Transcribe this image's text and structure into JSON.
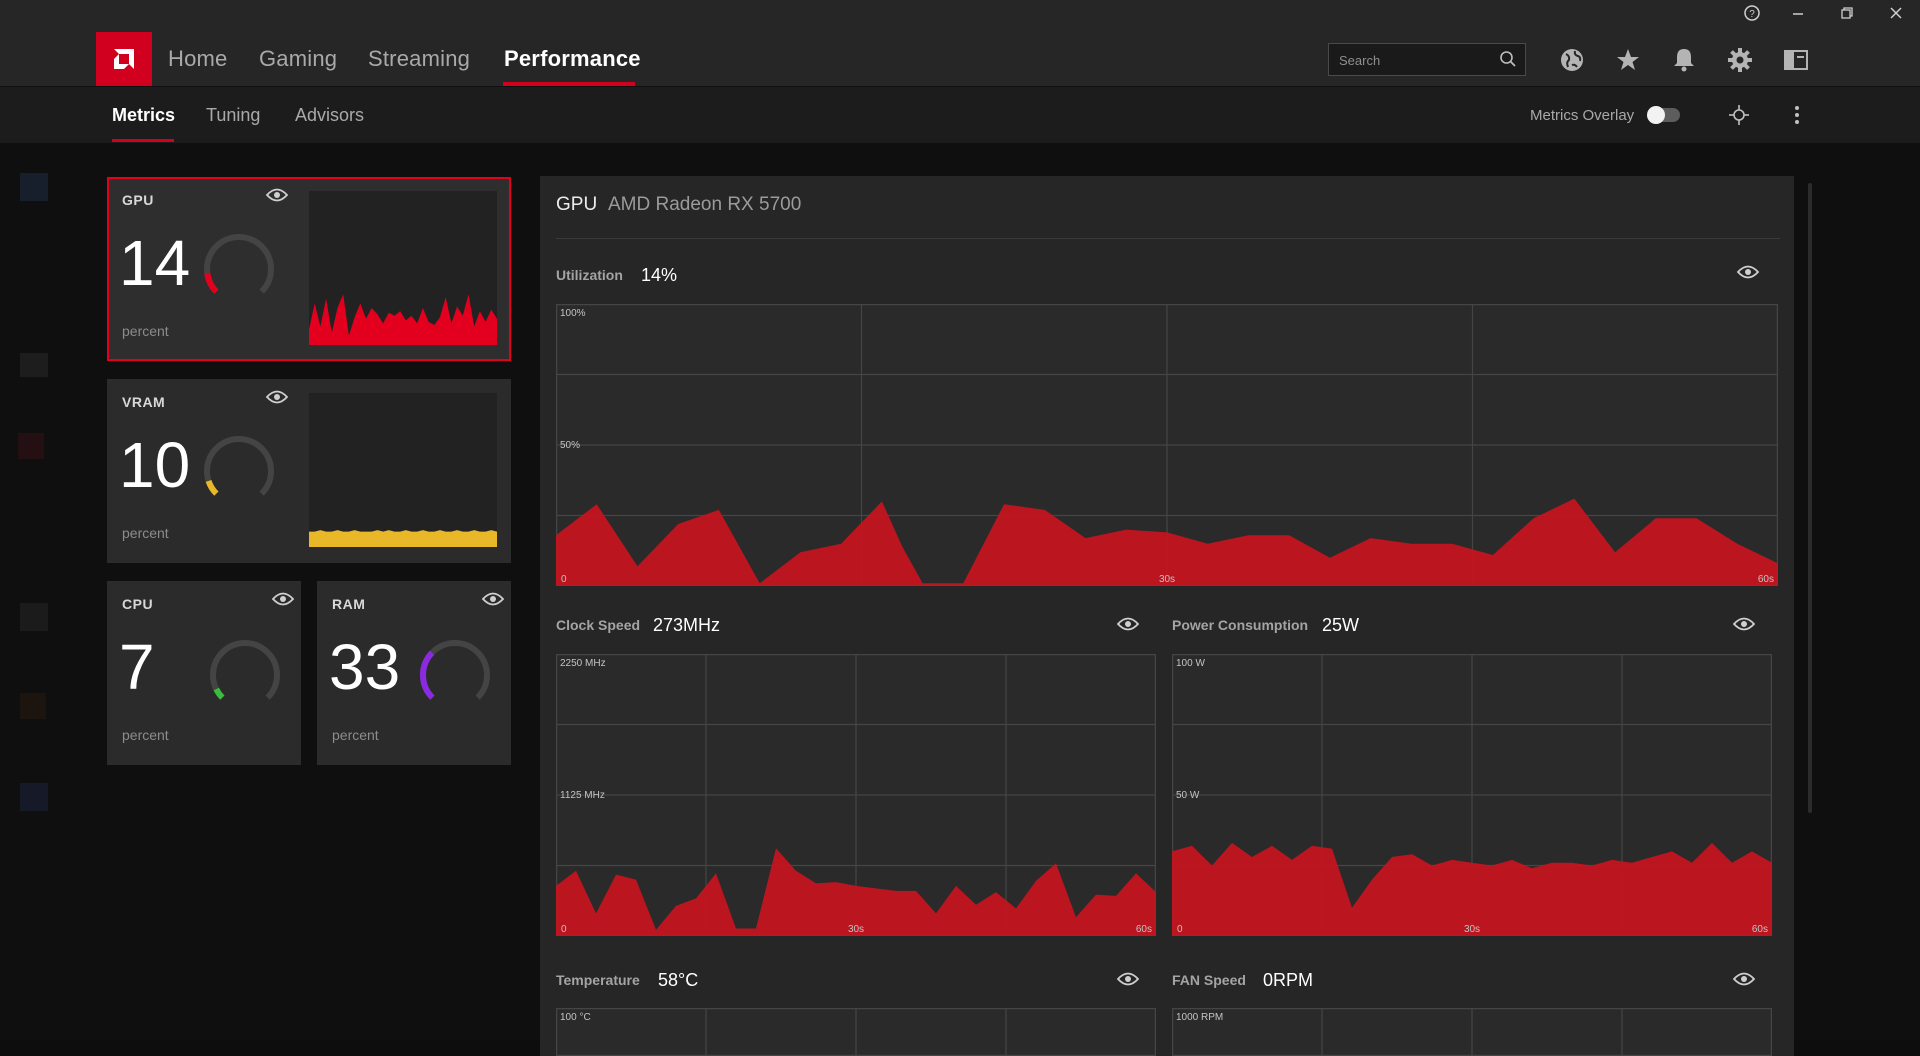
{
  "window": {
    "help_icon": "help-icon",
    "minimize_icon": "minimize-icon",
    "restore_icon": "restore-icon",
    "close_icon": "close-icon"
  },
  "nav": {
    "tabs": [
      {
        "label": "Home"
      },
      {
        "label": "Gaming"
      },
      {
        "label": "Streaming"
      },
      {
        "label": "Performance"
      }
    ],
    "active_tab": "Performance",
    "search_placeholder": "Search",
    "icons": [
      "globe-icon",
      "star-icon",
      "bell-icon",
      "gear-icon",
      "layout-icon"
    ]
  },
  "subnav": {
    "tabs": [
      {
        "label": "Metrics"
      },
      {
        "label": "Tuning"
      },
      {
        "label": "Advisors"
      }
    ],
    "active_tab": "Metrics",
    "overlay_label": "Metrics Overlay",
    "overlay_enabled": false
  },
  "tiles": {
    "gpu": {
      "label": "GPU",
      "value": "14",
      "unit": "percent",
      "color": "#e3001f",
      "fraction": 0.14
    },
    "vram": {
      "label": "VRAM",
      "value": "10",
      "unit": "percent",
      "color": "#e8b829",
      "fraction": 0.1
    },
    "cpu": {
      "label": "CPU",
      "value": "7",
      "unit": "percent",
      "color": "#3dbb3d",
      "fraction": 0.07
    },
    "ram": {
      "label": "RAM",
      "value": "33",
      "unit": "percent",
      "color": "#8a2be2",
      "fraction": 0.33
    }
  },
  "panel": {
    "title": "GPU",
    "subtitle": "AMD Radeon RX 5700",
    "metrics": {
      "utilization": {
        "label": "Utilization",
        "value": "14%"
      },
      "clock": {
        "label": "Clock Speed",
        "value": "273MHz"
      },
      "power": {
        "label": "Power Consumption",
        "value": "25W"
      },
      "temperature": {
        "label": "Temperature",
        "value": "58°C"
      },
      "fan": {
        "label": "FAN Speed",
        "value": "0RPM"
      }
    }
  },
  "chart_data": [
    {
      "type": "area",
      "name": "utilization",
      "y_top_label": "100%",
      "y_mid_label": "50%",
      "x_labels": [
        "0",
        "30s",
        "60s"
      ],
      "ylim": [
        0,
        100
      ],
      "xlim": [
        0,
        60
      ],
      "x": [
        0,
        2,
        4,
        6,
        8,
        10,
        12,
        14,
        16,
        17,
        18,
        20,
        22,
        24,
        26,
        28,
        30,
        32,
        34,
        36,
        38,
        40,
        42,
        44,
        46,
        48,
        50,
        52,
        54,
        56,
        58,
        60
      ],
      "values": [
        18,
        29,
        7,
        22,
        27,
        1,
        12,
        15,
        30,
        14,
        1,
        1,
        29,
        27,
        17,
        20,
        19,
        15,
        18,
        18,
        10,
        17,
        15,
        15,
        11,
        24,
        31,
        12,
        24,
        24,
        15,
        8
      ]
    },
    {
      "type": "area",
      "name": "clock",
      "y_top_label": "2250 MHz",
      "y_mid_label": "1125 MHz",
      "x_labels": [
        "0",
        "30s",
        "60s"
      ],
      "ylim": [
        0,
        2250
      ],
      "xlim": [
        0,
        60
      ],
      "x": [
        0,
        2,
        4,
        6,
        8,
        10,
        12,
        14,
        16,
        18,
        20,
        22,
        24,
        26,
        28,
        30,
        32,
        34,
        36,
        38,
        40,
        42,
        44,
        46,
        48,
        50,
        52,
        54,
        56,
        58,
        60
      ],
      "values": [
        400,
        520,
        180,
        490,
        450,
        50,
        240,
        300,
        500,
        60,
        60,
        700,
        520,
        420,
        430,
        400,
        380,
        360,
        360,
        180,
        400,
        250,
        350,
        220,
        440,
        580,
        150,
        330,
        320,
        500,
        350
      ]
    },
    {
      "type": "area",
      "name": "power",
      "y_top_label": "100 W",
      "y_mid_label": "50 W",
      "x_labels": [
        "0",
        "30s",
        "60s"
      ],
      "ylim": [
        0,
        100
      ],
      "xlim": [
        0,
        60
      ],
      "x": [
        0,
        2,
        4,
        6,
        8,
        10,
        12,
        14,
        16,
        18,
        20,
        22,
        24,
        26,
        28,
        30,
        32,
        34,
        36,
        38,
        40,
        42,
        44,
        46,
        48,
        50,
        52,
        54,
        56,
        58,
        60
      ],
      "values": [
        30,
        32,
        25,
        33,
        28,
        32,
        27,
        32,
        31,
        10,
        20,
        28,
        29,
        25,
        27,
        26,
        25,
        27,
        24,
        26,
        26,
        25,
        27,
        26,
        28,
        30,
        26,
        33,
        26,
        30,
        26
      ]
    },
    {
      "type": "area",
      "name": "temperature",
      "y_top_label": "100 °C",
      "x_labels": [],
      "ylim": [
        0,
        100
      ],
      "xlim": [
        0,
        60
      ]
    },
    {
      "type": "area",
      "name": "fan",
      "y_top_label": "1000 RPM",
      "x_labels": [],
      "ylim": [
        0,
        1000
      ],
      "xlim": [
        0,
        60
      ]
    }
  ],
  "sparklines": {
    "gpu": [
      10,
      27,
      12,
      30,
      8,
      24,
      33,
      6,
      18,
      27,
      17,
      24,
      20,
      14,
      21,
      19,
      22,
      16,
      19,
      14,
      24,
      15,
      13,
      18,
      31,
      14,
      25,
      19,
      33,
      12,
      22,
      15,
      23,
      17
    ],
    "vram": [
      10,
      10,
      11,
      10,
      10,
      11,
      10,
      10,
      11,
      10,
      10,
      10,
      11,
      10,
      11,
      10,
      10,
      11,
      10,
      10,
      11,
      10,
      10,
      11,
      10,
      10,
      11,
      10,
      10,
      11,
      10,
      10,
      11,
      10
    ]
  },
  "colors": {
    "accent": "#d1001f",
    "area_fill": "#c8141e",
    "panel_bg": "#262626"
  }
}
